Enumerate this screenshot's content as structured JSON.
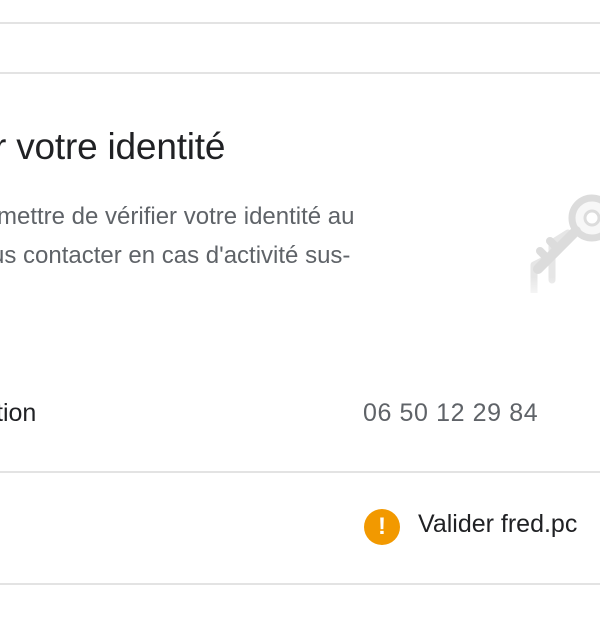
{
  "section": {
    "title": "r votre identité",
    "description_line1": "rmettre de vérifier votre identité au",
    "description_line2": "us contacter en cas d'activité sus-"
  },
  "illustration": {
    "icon": "key-icon"
  },
  "rows": [
    {
      "label": "tion",
      "value": "06 50 12 29 84"
    },
    {
      "status_icon": "warning-icon",
      "status_color": "#f29900",
      "status_symbol": "!",
      "value": "Valider fred.pc"
    }
  ],
  "colors": {
    "divider": "#e3e3e3",
    "primary_text": "#202124",
    "secondary_text": "#5f6368",
    "warning": "#f29900"
  }
}
